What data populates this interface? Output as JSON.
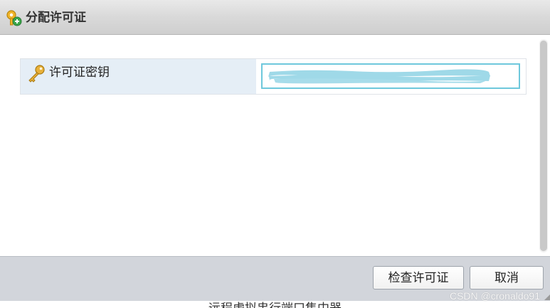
{
  "dialog": {
    "title": "分配许可证"
  },
  "form": {
    "license_key_label": "许可证密钥",
    "license_key_value": ""
  },
  "buttons": {
    "check_license": "检查许可证",
    "cancel": "取消"
  },
  "background": {
    "bottom_text": "远程虚拟串行端口集中器"
  },
  "watermark": "CSDN @cronaldo91",
  "colors": {
    "input_border": "#6ec8dc",
    "redaction": "#9fd9e8",
    "label_bg": "#e5eef6",
    "footer_bg": "#d2d5db"
  },
  "icons": {
    "title": "license-add-icon",
    "label": "key-icon"
  }
}
